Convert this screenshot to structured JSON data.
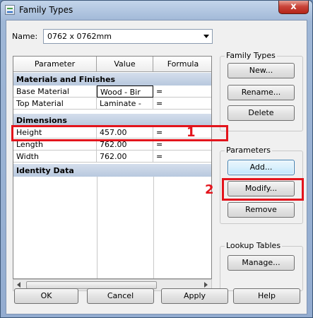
{
  "window": {
    "title": "Family Types",
    "close_label": "x"
  },
  "name_field": {
    "label": "Name:",
    "value": "0762 x 0762mm"
  },
  "grid": {
    "columns": [
      "Parameter",
      "Value",
      "Formula"
    ],
    "sections": [
      {
        "title": "Materials and Finishes",
        "rows": [
          {
            "parameter": "Base Material",
            "value": "Wood - Bir",
            "formula": "="
          },
          {
            "parameter": "Top Material",
            "value": "Laminate -",
            "formula": "="
          }
        ]
      },
      {
        "title": "Dimensions",
        "rows": [
          {
            "parameter": "Height",
            "value": "457.00",
            "formula": "="
          },
          {
            "parameter": "Length",
            "value": "762.00",
            "formula": "="
          },
          {
            "parameter": "Width",
            "value": "762.00",
            "formula": "="
          }
        ]
      },
      {
        "title": "Identity Data",
        "rows": []
      }
    ]
  },
  "family_types": {
    "title": "Family Types",
    "new_label": "New...",
    "rename_label": "Rename...",
    "delete_label": "Delete"
  },
  "parameters": {
    "title": "Parameters",
    "add_label": "Add...",
    "modify_label": "Modify...",
    "remove_label": "Remove"
  },
  "lookup_tables": {
    "title": "Lookup Tables",
    "manage_label": "Manage..."
  },
  "footer": {
    "ok_label": "OK",
    "cancel_label": "Cancel",
    "apply_label": "Apply",
    "help_label": "Help"
  },
  "annotations": {
    "marker_1": "1",
    "marker_2": "2",
    "color": "#e3141c"
  }
}
